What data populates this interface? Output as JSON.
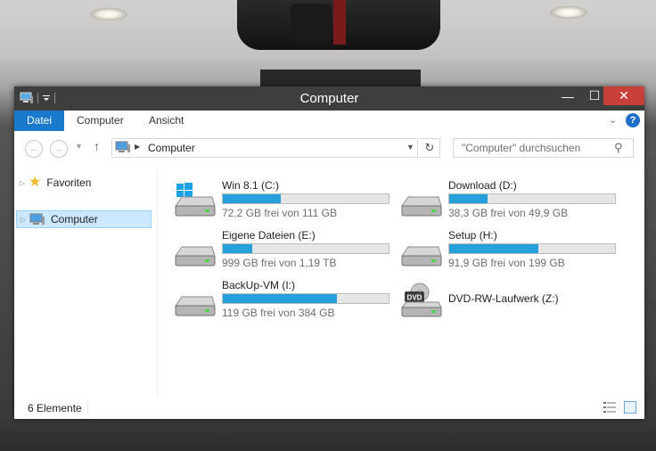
{
  "window": {
    "title": "Computer"
  },
  "title_buttons": {
    "minimize": "—",
    "maximize": "☐",
    "close": "✕"
  },
  "ribbon": {
    "tabs": [
      "Datei",
      "Computer",
      "Ansicht"
    ],
    "help": "?"
  },
  "address": {
    "breadcrumb": "Computer",
    "search_placeholder": "\"Computer\" durchsuchen"
  },
  "nav_pane": {
    "items": [
      {
        "label": "Favoriten",
        "icon": "star-icon",
        "selected": false
      },
      {
        "label": "Computer",
        "icon": "computer-icon",
        "selected": true
      }
    ]
  },
  "drives": [
    {
      "name": "Win 8.1 (C:)",
      "info": "72,2 GB frei von 111 GB",
      "used_fraction": 0.35,
      "icon": "windows-drive-icon"
    },
    {
      "name": "Download (D:)",
      "info": "38,3 GB frei von 49,9 GB",
      "used_fraction": 0.23,
      "icon": "hard-drive-icon"
    },
    {
      "name": "Eigene Dateien (E:)",
      "info": "999 GB frei von 1,19 TB",
      "used_fraction": 0.18,
      "icon": "hard-drive-icon"
    },
    {
      "name": "Setup (H:)",
      "info": "91,9 GB frei von 199 GB",
      "used_fraction": 0.54,
      "icon": "hard-drive-icon"
    },
    {
      "name": "BackUp-VM (I:)",
      "info": "119 GB frei von 384 GB",
      "used_fraction": 0.69,
      "icon": "hard-drive-icon"
    },
    {
      "name": "DVD-RW-Laufwerk (Z:)",
      "info": "",
      "used_fraction": null,
      "icon": "dvd-drive-icon",
      "badge": "DVD"
    }
  ],
  "status": {
    "count": "6 Elemente"
  },
  "colors": {
    "accent": "#1979ca",
    "bar_fill": "#26a0da",
    "close": "#c7403a",
    "selection": "#cce8ff"
  }
}
